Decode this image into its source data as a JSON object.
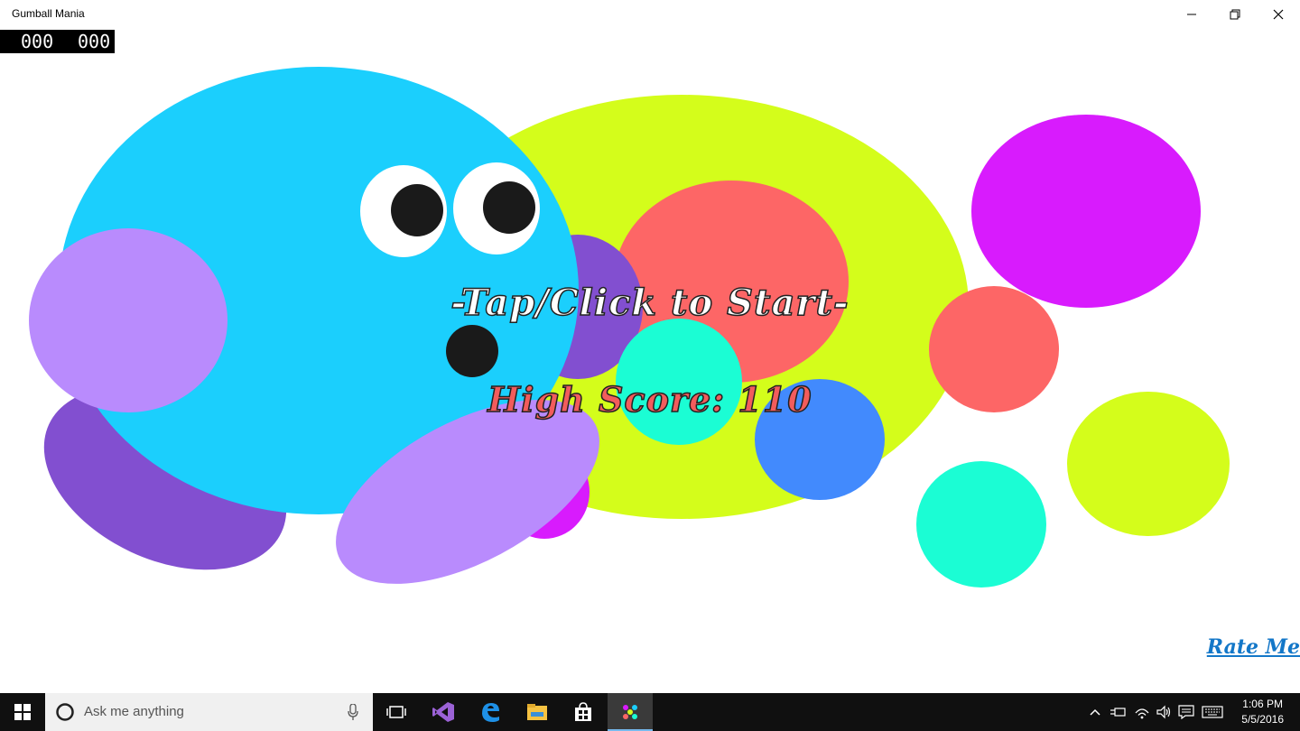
{
  "window": {
    "title": "Gumball Mania",
    "minimize_label": "─",
    "restore_label": "❐",
    "close_label": "✕"
  },
  "hud": {
    "score_left": "000",
    "score_right": "000"
  },
  "game": {
    "start_prompt": "-Tap/Click to Start-",
    "high_score": "High Score: 110",
    "rate_me": "Rate Me"
  },
  "colors": {
    "blue": "#1bcffd",
    "lime": "#d4fd1b",
    "salmon": "#fd6666",
    "magenta": "#d81bfd",
    "purple": "#824fd0",
    "lavender": "#b98bfd",
    "teal": "#1bfdd4",
    "royal_blue": "#428afd"
  },
  "taskbar": {
    "search_placeholder": "Ask me anything",
    "time": "1:06 PM",
    "date": "5/5/2016"
  }
}
